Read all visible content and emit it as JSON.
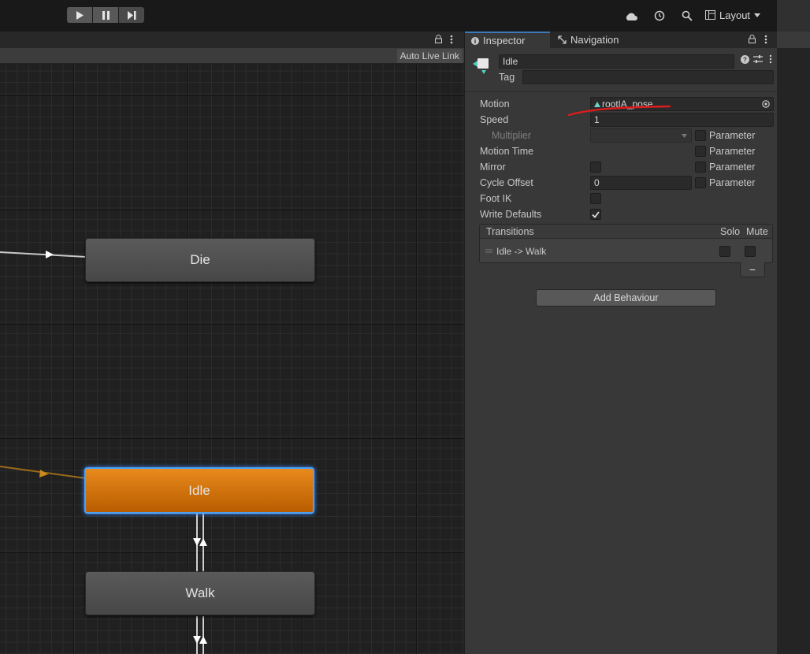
{
  "toolbar": {
    "play_icon": "play-icon",
    "pause_icon": "pause-icon",
    "step_icon": "step-icon",
    "layout_label": "Layout"
  },
  "animator": {
    "auto_live_link": "Auto Live Link",
    "states": [
      {
        "name": "Die"
      },
      {
        "name": "Idle"
      },
      {
        "name": "Walk"
      }
    ]
  },
  "inspector": {
    "tabs": [
      {
        "label": "Inspector"
      },
      {
        "label": "Navigation"
      }
    ],
    "state_name": "Idle",
    "tag_label": "Tag",
    "tag_value": "",
    "motion_label": "Motion",
    "motion_value": "root|A_pose",
    "speed_label": "Speed",
    "speed_value": "1",
    "multiplier_label": "Multiplier",
    "motion_time_label": "Motion Time",
    "mirror_label": "Mirror",
    "cycle_offset_label": "Cycle Offset",
    "cycle_offset_value": "0",
    "foot_ik_label": "Foot IK",
    "write_defaults_label": "Write Defaults",
    "write_defaults_checked": true,
    "parameter_label": "Parameter",
    "transitions": {
      "header": "Transitions",
      "solo_label": "Solo",
      "mute_label": "Mute",
      "rows": [
        {
          "label": "Idle -> Walk"
        }
      ],
      "remove_label": "−"
    },
    "add_behaviour_label": "Add Behaviour"
  },
  "colors": {
    "accent": "#3a79bb",
    "selected_state": "#c96c08",
    "annotation": "#d91d1d"
  }
}
